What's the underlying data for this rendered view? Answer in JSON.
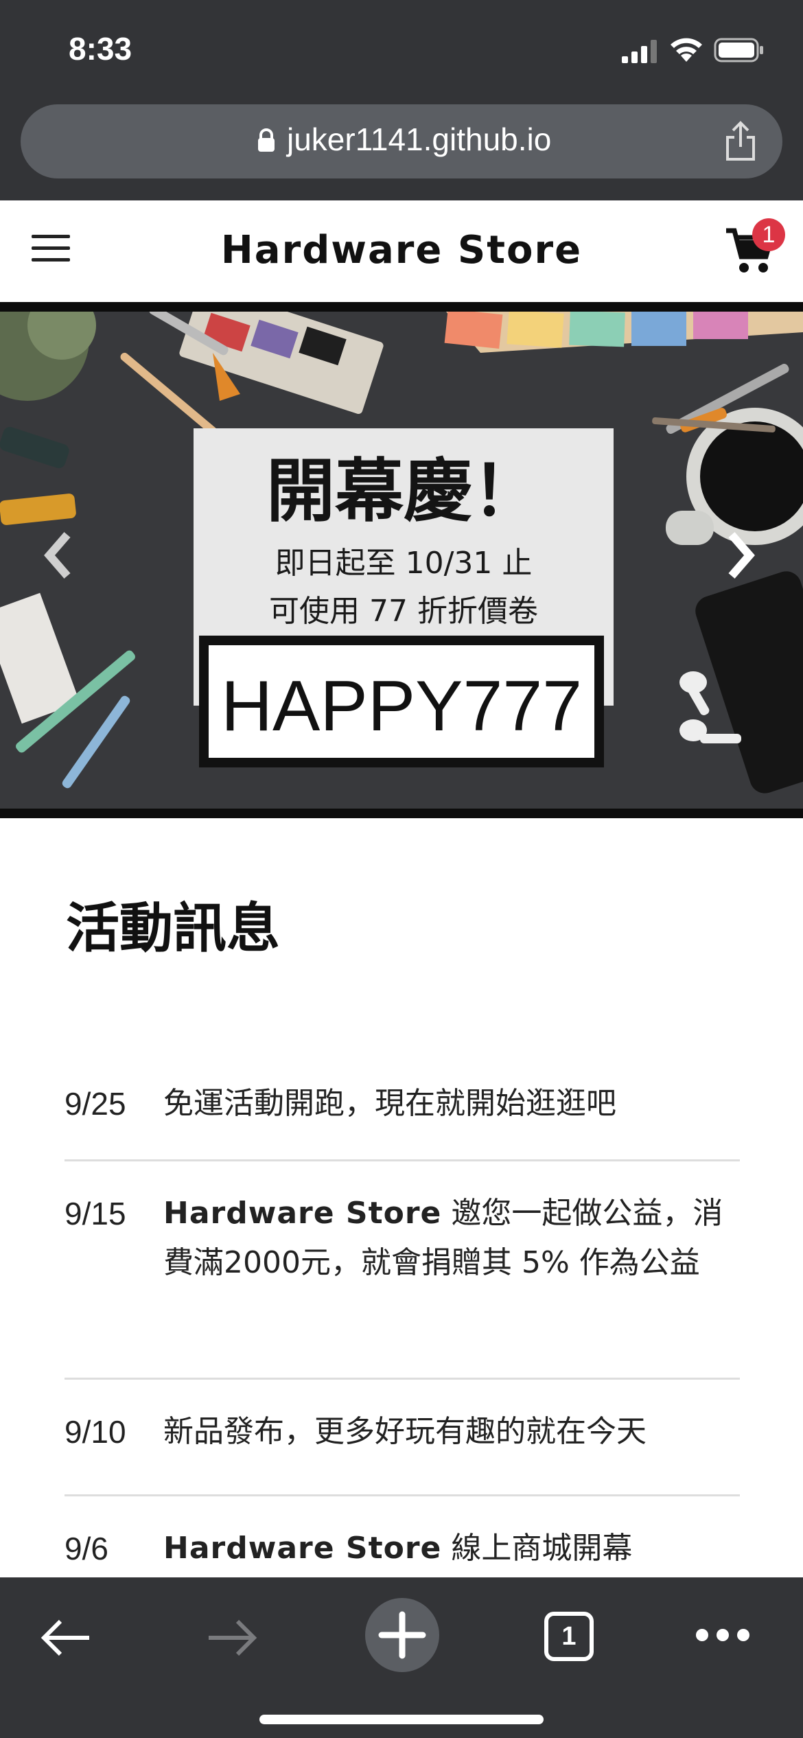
{
  "status_bar": {
    "time": "8:33",
    "icons": [
      "signal-icon",
      "wifi-icon",
      "battery-icon"
    ]
  },
  "browser": {
    "url": "juker1141.github.io",
    "icons": [
      "lock-icon",
      "share-icon"
    ]
  },
  "navbar": {
    "brand": "Hardware Store",
    "cart_count": "1",
    "icons": [
      "menu-icon",
      "cart-icon"
    ]
  },
  "carousel": {
    "title": "開幕慶！",
    "line1": "即日起至 10/31 止",
    "line2": "可使用 77 折折價卷",
    "code": "HAPPY777",
    "icons": [
      "chevron-left-icon",
      "chevron-right-icon"
    ]
  },
  "news": {
    "title": "活動訊息",
    "items": [
      {
        "date": "9/25",
        "brand": "",
        "text": "免運活動開跑，現在就開始逛逛吧"
      },
      {
        "date": "9/15",
        "brand": "Hardware Store",
        "text": " 邀您一起做公益，消費滿2000元，就會捐贈其 5% 作為公益"
      },
      {
        "date": "9/10",
        "brand": "",
        "text": "新品發布，更多好玩有趣的就在今天"
      },
      {
        "date": "9/6",
        "brand": "Hardware Store",
        "text": " 線上商城開幕"
      }
    ]
  },
  "toolbar": {
    "tab_count": "1",
    "icons": [
      "back-arrow-icon",
      "forward-arrow-icon",
      "plus-icon",
      "tabs-icon",
      "more-icon"
    ]
  },
  "colors": {
    "chrome": "#333437",
    "pill": "#5b5e63",
    "badge": "#dc3545"
  }
}
